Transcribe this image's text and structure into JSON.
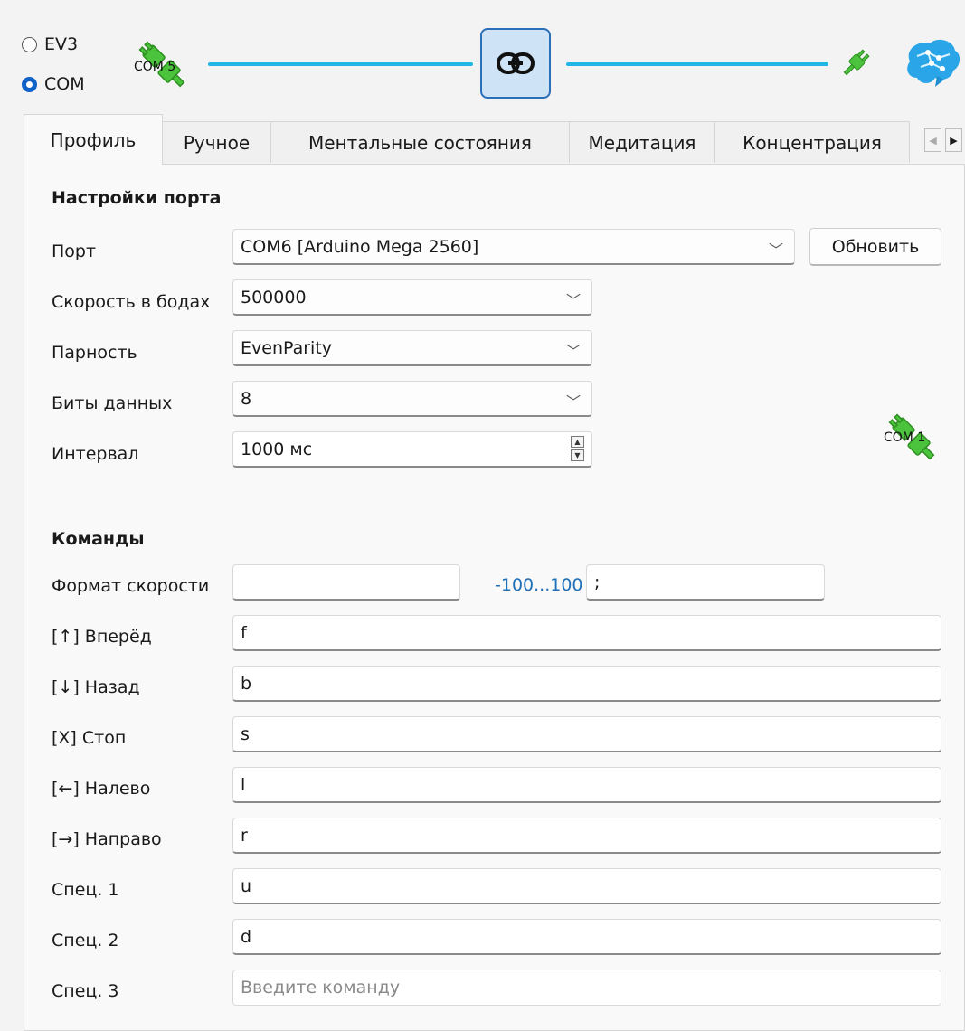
{
  "mode": {
    "options": [
      {
        "label": "EV3",
        "selected": false
      },
      {
        "label": "COM",
        "selected": true
      }
    ]
  },
  "connection": {
    "left_device_label": "COM 5",
    "right_status_icon": "plug-connected-icon",
    "link_icon": "link-icon",
    "brain_icon": "brain-icon",
    "line_color": "#20b6e6",
    "accent_color": "#2b6fb8"
  },
  "tabs": [
    {
      "label": "Профиль",
      "active": true
    },
    {
      "label": "Ручное",
      "active": false
    },
    {
      "label": "Ментальные состояния",
      "active": false
    },
    {
      "label": "Медитация",
      "active": false
    },
    {
      "label": "Концентрация",
      "active": false
    }
  ],
  "port_settings": {
    "title": "Настройки порта",
    "port": {
      "label": "Порт",
      "value": "COM6 [Arduino Mega 2560]"
    },
    "refresh_button": "Обновить",
    "baud": {
      "label": "Скорость в бодах",
      "value": "500000"
    },
    "parity": {
      "label": "Парность",
      "value": "EvenParity"
    },
    "data_bits": {
      "label": "Биты данных",
      "value": "8"
    },
    "interval": {
      "label": "Интервал",
      "value": "1000 мс"
    },
    "side_device_label": "COM 1"
  },
  "commands": {
    "title": "Команды",
    "speed_format": {
      "label": "Формат скорости",
      "prefix": "",
      "range": "-100...100",
      "suffix": ";"
    },
    "items": [
      {
        "label": "[↑] Вперёд",
        "value": "f"
      },
      {
        "label": "[↓] Назад",
        "value": "b"
      },
      {
        "label": "[X] Стоп",
        "value": "s"
      },
      {
        "label": "[←] Налево",
        "value": "l"
      },
      {
        "label": "[→] Направо",
        "value": "r"
      },
      {
        "label": "Спец. 1",
        "value": "u"
      },
      {
        "label": "Спец. 2",
        "value": "d"
      },
      {
        "label": "Спец. 3",
        "value": "",
        "placeholder": "Введите команду"
      }
    ]
  }
}
